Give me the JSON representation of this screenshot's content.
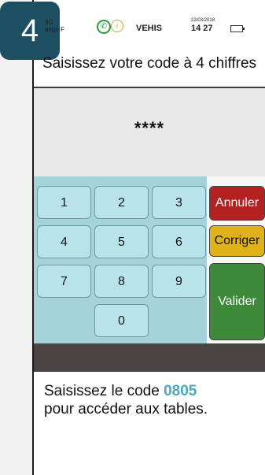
{
  "step": {
    "number": "4"
  },
  "status_bar": {
    "network": "3G",
    "operator_short": "ange F",
    "operator": "VEHIS",
    "date": "22/03/2018",
    "time": "14 27"
  },
  "prompt": {
    "title": "Saisissez votre code à 4 chiffres"
  },
  "code": {
    "masked": "****"
  },
  "keypad": {
    "keys": [
      "1",
      "2",
      "3",
      "4",
      "5",
      "6",
      "7",
      "8",
      "9",
      "0"
    ]
  },
  "actions": {
    "cancel": "Annuler",
    "correct": "Corriger",
    "validate": "Valider"
  },
  "instruction": {
    "before": "Saisissez le code ",
    "code": "0805",
    "after": "pour accéder aux tables."
  },
  "colors": {
    "badge": "#1d4f62",
    "keypad_bg": "#a5d3dc",
    "cancel": "#b42121",
    "correct": "#dfb21a",
    "validate": "#3f8a3a",
    "highlight": "#4ca7c4"
  }
}
